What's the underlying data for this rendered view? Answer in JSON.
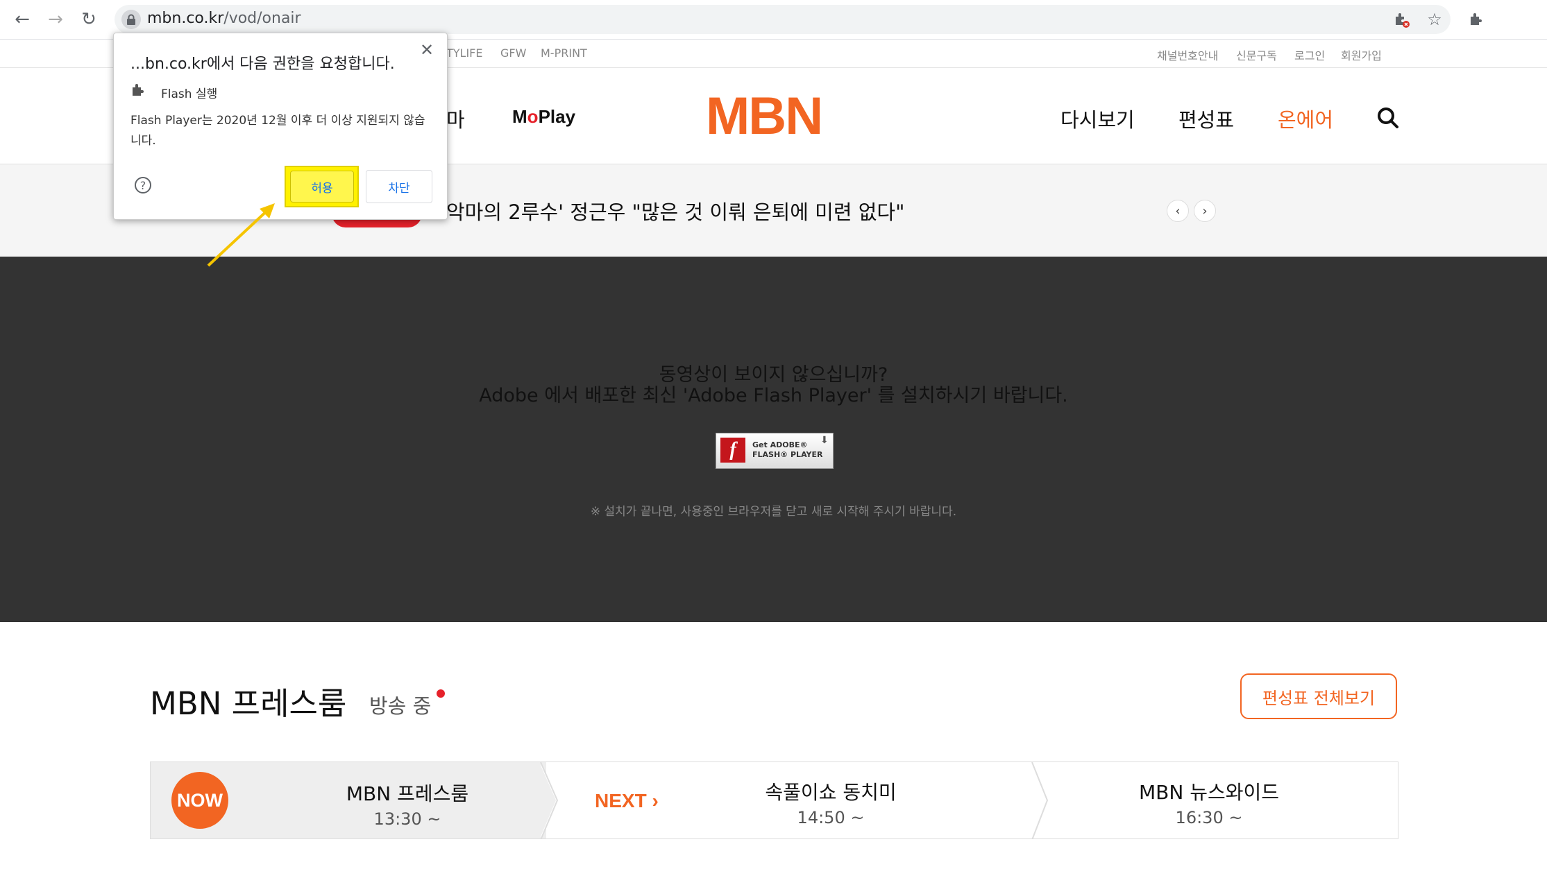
{
  "browser": {
    "url_host": "mbn.co.kr",
    "url_path": "/vod/onair"
  },
  "utility_nav": {
    "left_items": [
      "TYLIFE",
      "GFW",
      "M-PRINT"
    ],
    "right_items": [
      "채널번호안내",
      "신문구독",
      "로그인",
      "회원가입"
    ]
  },
  "header": {
    "logo": "MBN",
    "left_partial": "마",
    "moplay_pre": "M",
    "moplay_o": "o",
    "moplay_post": "Play",
    "nav": [
      "다시보기",
      "편성표",
      "온에어"
    ]
  },
  "ticker": {
    "headline": "악마의 2루수' 정근우 \"많은 것 이뤄 은퇴에 미련 없다\"",
    "prev": "‹",
    "next": "›"
  },
  "player": {
    "message_line1": "동영상이 보이지 않으십니까?",
    "message_line2": "Adobe 에서 배포한 최신 'Adobe Flash Player' 를 설치하시기 바랍니다.",
    "get_flash_line1": "Get ADOBE®",
    "get_flash_line2": "FLASH® PLAYER",
    "notice": "※ 설치가 끝나면, 사용중인 브라우저를 닫고 새로 시작해 주시기 바랍니다."
  },
  "section": {
    "title": "MBN 프레스룸",
    "live_label": "방송 중",
    "full_schedule_button": "편성표 전체보기"
  },
  "schedule": {
    "now_badge": "NOW",
    "next_label": "NEXT",
    "next_arrow": "›",
    "programs": [
      {
        "title": "MBN 프레스룸",
        "time": "13:30 ~"
      },
      {
        "title": "속풀이쇼 동치미",
        "time": "14:50 ~"
      },
      {
        "title": "MBN 뉴스와이드",
        "time": "16:30 ~"
      }
    ]
  },
  "permission_popup": {
    "title": "...bn.co.kr에서 다음 권한을 요청합니다.",
    "permission": "Flash 실행",
    "description": "Flash Player는 2020년 12월 이후 더 이상 지원되지 않습니다.",
    "allow": "허용",
    "block": "차단",
    "close": "✕",
    "help": "?"
  },
  "colors": {
    "brand": "#f26522",
    "highlight": "#fff100",
    "annotation_arrow": "#f5c400"
  }
}
